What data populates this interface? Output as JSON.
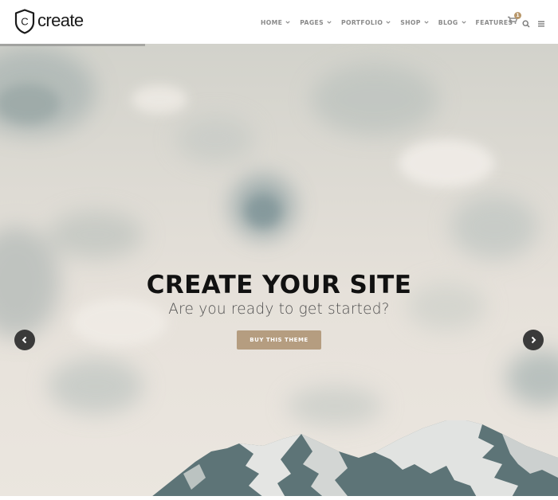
{
  "brand": {
    "name": "create",
    "logo_letter": "C"
  },
  "nav": {
    "items": [
      {
        "label": "HOME",
        "has_dropdown": true
      },
      {
        "label": "PAGES",
        "has_dropdown": true
      },
      {
        "label": "PORTFOLIO",
        "has_dropdown": true
      },
      {
        "label": "SHOP",
        "has_dropdown": true
      },
      {
        "label": "BLOG",
        "has_dropdown": true
      },
      {
        "label": "FEATURES",
        "has_dropdown": false
      }
    ],
    "cart_count": "1",
    "icons": [
      "cart-icon",
      "search-icon",
      "menu-icon"
    ]
  },
  "hero": {
    "title": "CREATE YOUR SITE",
    "subtitle": "Are you ready to get started?",
    "button_label": "BUY THIS THEME",
    "slide_progress": 0.26,
    "prev_icon": "chevron-left-icon",
    "next_icon": "chevron-right-icon"
  },
  "colors": {
    "accent": "#b59d80",
    "badge": "#b8976a",
    "nav_text": "#8a8a8a",
    "arrow_bg": "#3a3a3a"
  }
}
